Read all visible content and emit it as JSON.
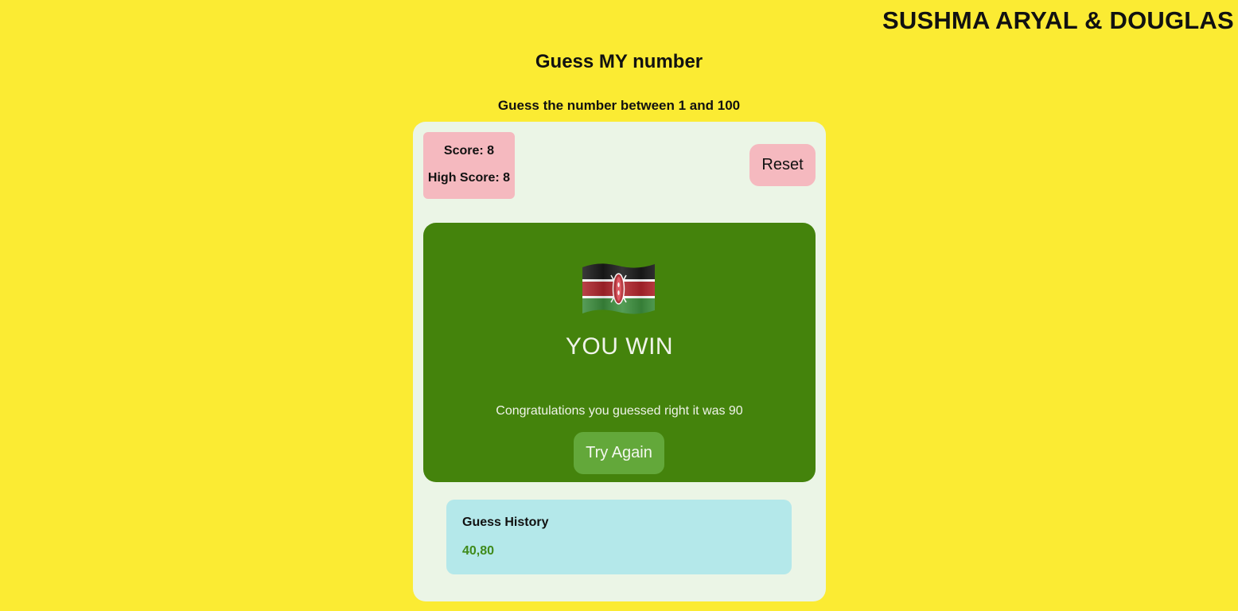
{
  "header": {
    "authors": "SUSHMA ARYAL & DOUGLAS",
    "title": "Guess MY number",
    "subtitle": "Guess the number between 1 and 100"
  },
  "scoreboard": {
    "score_label": "Score: 8",
    "high_score_label": "High Score: 8"
  },
  "reset_button": "Reset",
  "result": {
    "flag_icon": "kenya-flag-icon",
    "title": "YOU WIN",
    "message": "Congratulations you guessed right it was 90",
    "try_again_button": "Try Again"
  },
  "history": {
    "title": "Guess History",
    "values": "40,80"
  },
  "colors": {
    "background": "#fbeb33",
    "card": "#ebf5e6",
    "score_box": "#f5b9bf",
    "win_panel": "#44830c",
    "try_again": "#63a83a",
    "history_box": "#b4e8ea",
    "history_text": "#3f8a1a"
  }
}
